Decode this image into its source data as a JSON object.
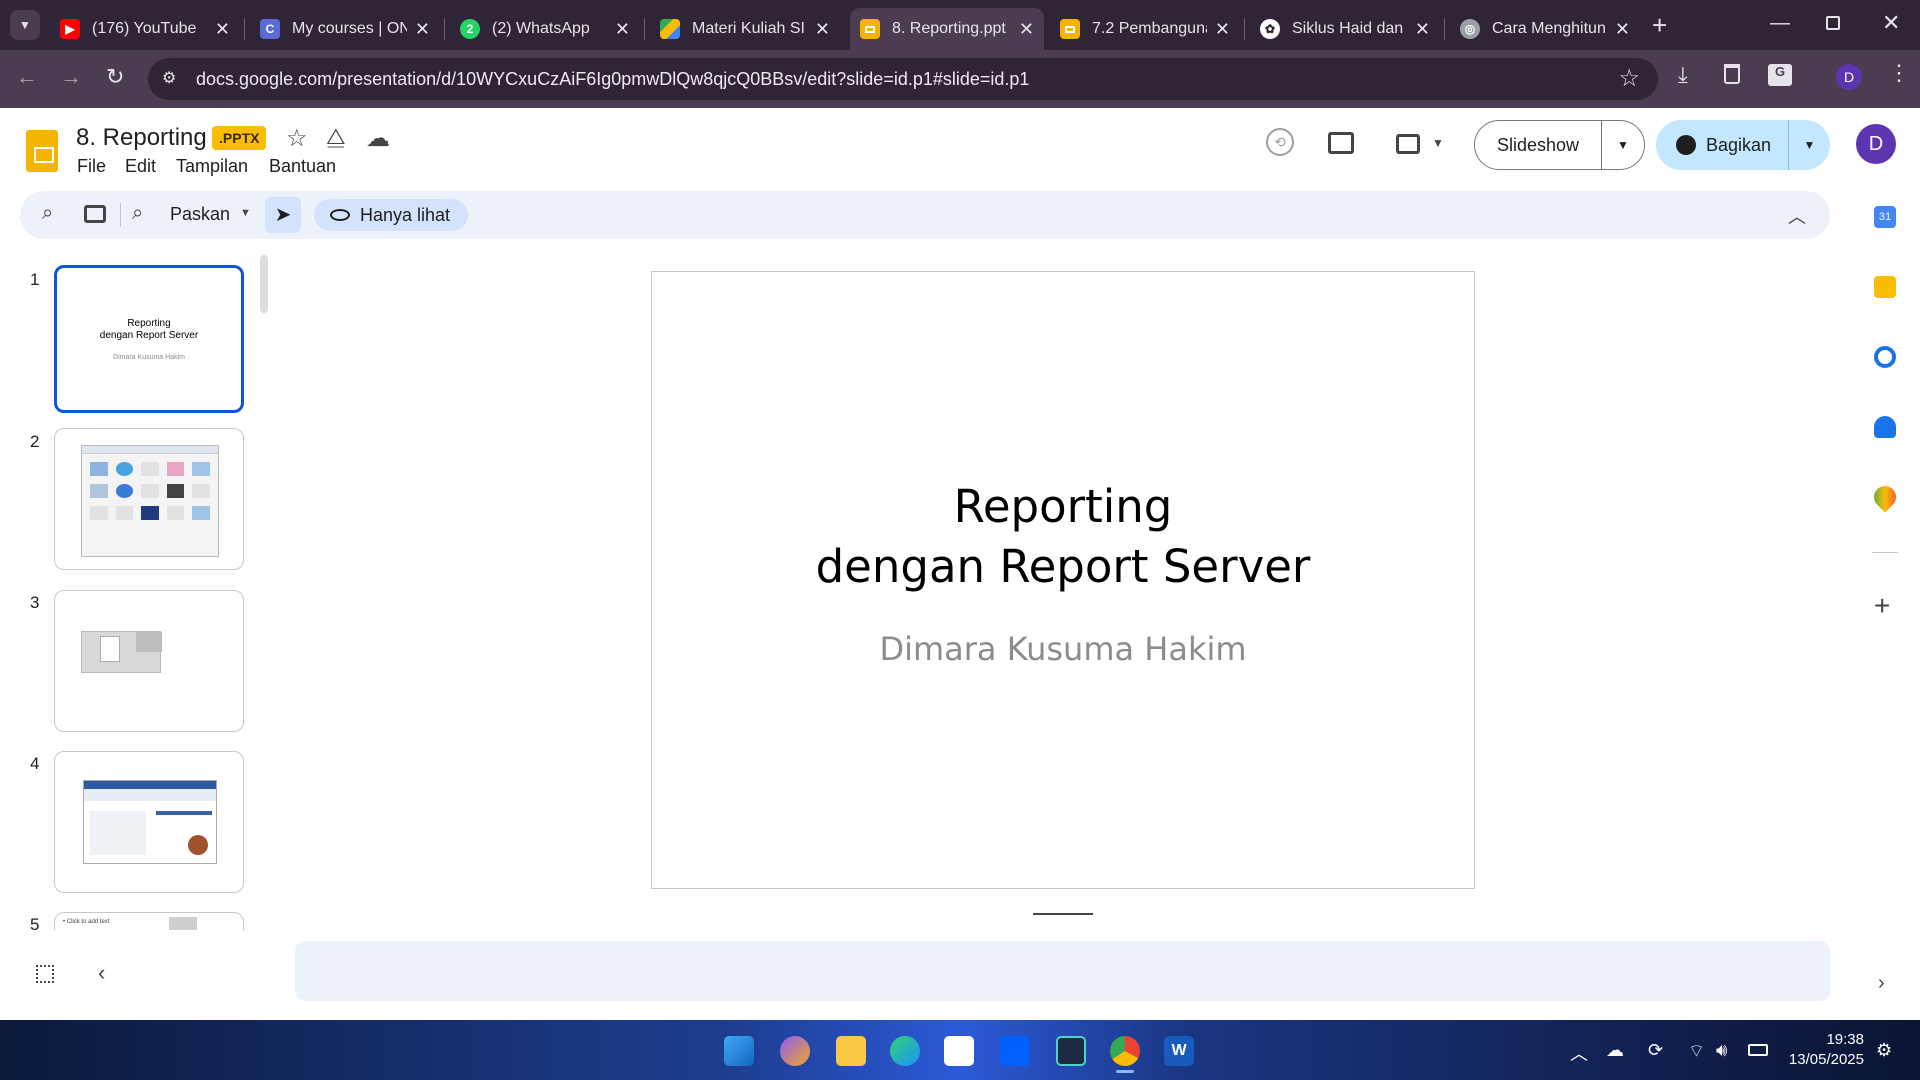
{
  "browser": {
    "tabs": [
      {
        "title": "(176) YouTube",
        "icon": "youtube-icon",
        "color": "#ff0000"
      },
      {
        "title": "My courses | ON",
        "icon": "course-icon",
        "color": "#5b6bd6"
      },
      {
        "title": "(2) WhatsApp",
        "icon": "whatsapp-icon",
        "color": "#25d366"
      },
      {
        "title": "Materi Kuliah SI",
        "icon": "drive-icon",
        "color": "#34a853"
      },
      {
        "title": "8. Reporting.ppt",
        "icon": "slides-icon",
        "color": "#f4b400"
      },
      {
        "title": "7.2 Pembanguna",
        "icon": "slides-icon",
        "color": "#f4b400"
      },
      {
        "title": "Siklus Haid dan",
        "icon": "chatgpt-icon",
        "color": "#ffffff"
      },
      {
        "title": "Cara Menghitun",
        "icon": "globe-icon",
        "color": "#9aa0a6"
      }
    ],
    "active_tab_index": 4,
    "url": "docs.google.com/presentation/d/10WYCxuCzAiF6Ig0pmwDlQw8qjcQ0BBsv/edit?slide=id.p1#slide=id.p1",
    "profile_initial": "D"
  },
  "doc": {
    "title": "8. Reporting",
    "badge": ".PPTX",
    "menus": [
      "File",
      "Edit",
      "Tampilan",
      "Bantuan"
    ],
    "slideshow_label": "Slideshow",
    "share_label": "Bagikan",
    "user_initial": "D"
  },
  "toolbar": {
    "zoom_label": "Paskan",
    "view_only_label": "Hanya lihat"
  },
  "filmstrip": {
    "slides": [
      {
        "number": "1",
        "title_line1": "Reporting",
        "title_line2": "dengan Report Server",
        "subtitle": "Dimara Kusuma Hakim"
      },
      {
        "number": "2"
      },
      {
        "number": "3"
      },
      {
        "number": "4"
      },
      {
        "number": "5",
        "text": "• Click to add text"
      }
    ]
  },
  "slide": {
    "title_line1": "Reporting",
    "title_line2": "dengan Report Server",
    "subtitle": "Dimara Kusuma Hakim"
  },
  "taskbar": {
    "time": "19:38",
    "date": "13/05/2025"
  },
  "colors": {
    "chrome_dark": "#2f2536",
    "chrome_mid": "#4b3c52",
    "accent_blue": "#0b57d0",
    "share_bg": "#c2e7ff",
    "slides_yellow": "#f4b400"
  }
}
